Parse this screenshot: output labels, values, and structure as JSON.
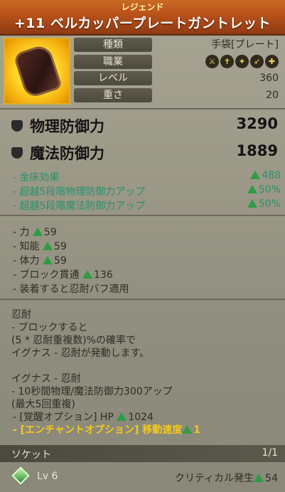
{
  "header": {
    "grade": "レジェンド",
    "name": "+11 ベルカッパープレートガントレット"
  },
  "icon": {
    "name": "gauntlet-item-icon"
  },
  "attrs": [
    {
      "label": "種類",
      "value": "手袋[プレート]"
    },
    {
      "label": "職業",
      "value": ""
    },
    {
      "label": "レベル",
      "value": "360"
    },
    {
      "label": "重さ",
      "value": "20"
    }
  ],
  "class_icons": [
    "warrior-icon",
    "cleric-icon",
    "mage-icon",
    "archer-icon",
    "rogue-icon"
  ],
  "defense": [
    {
      "label": "物理防御力",
      "value": "3290"
    },
    {
      "label": "魔法防御力",
      "value": "1889"
    }
  ],
  "green_lines": [
    {
      "label": "- 金床効果",
      "value": "488"
    },
    {
      "label": "- 超越5段階物理防御力アップ",
      "value": "50%"
    },
    {
      "label": "- 超越5段階魔法防御力アップ",
      "value": "50%"
    }
  ],
  "stats": [
    {
      "label": "- 力",
      "value": "59"
    },
    {
      "label": "- 知能",
      "value": "59"
    },
    {
      "label": "- 体力",
      "value": "59"
    },
    {
      "label": "- ブロック貫通",
      "value": "136"
    },
    {
      "label": "- 装着すると忍耐バフ適用",
      "value": ""
    }
  ],
  "desc": {
    "title": "忍耐",
    "lines": [
      "- ブロックすると",
      "(5 * 忍耐重複数)%の確率で",
      "イグナス - 忍耐が発動します。"
    ],
    "title2": "イグナス - 忍耐",
    "lines2": [
      "- 10秒間物理/魔法防御力300アップ",
      "(最大5回重複)"
    ]
  },
  "awaken": {
    "label": "- [覚醒オプション] HP",
    "value": "1024"
  },
  "enchant": {
    "label": "- [エンチャントオプション] 移動速度",
    "value": "1"
  },
  "socket": {
    "label": "ソケット",
    "value": "1/1"
  },
  "bottom": {
    "level": "Lv 6",
    "crit_label": "クリティカル発生",
    "crit_value": "54"
  }
}
